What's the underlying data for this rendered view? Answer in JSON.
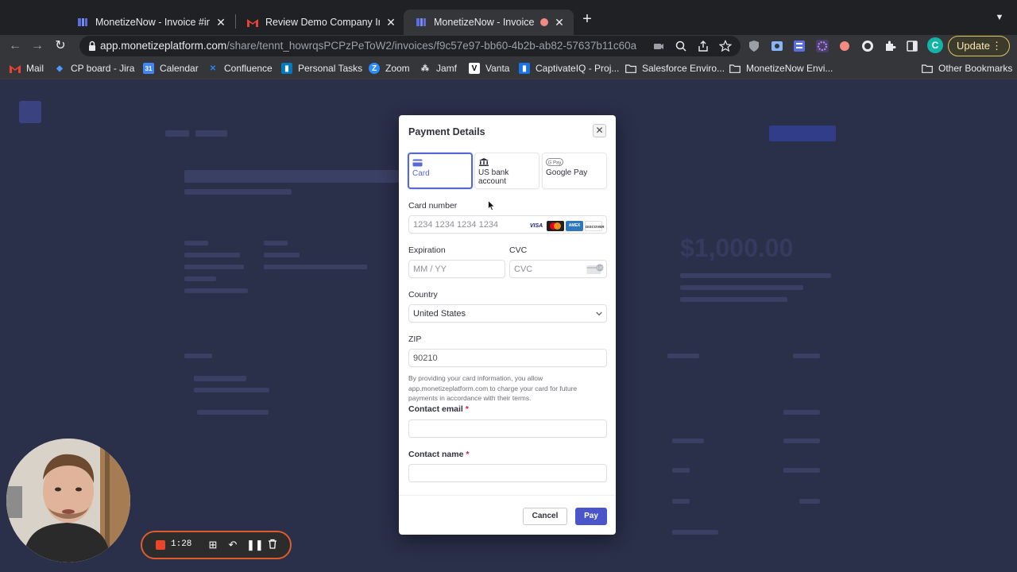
{
  "browser": {
    "tabs": [
      {
        "title": "MonetizeNow - Invoice #invce...",
        "active": false,
        "favicon": "monetizenow-favicon"
      },
      {
        "title": "Review Demo Company Invoice...",
        "active": false,
        "favicon": "gmail-favicon"
      },
      {
        "title": "MonetizeNow - Invoice #in...",
        "active": true,
        "favicon": "monetizenow-favicon",
        "recording": true
      }
    ],
    "url_host": "app.monetizeplatform.com",
    "url_path": "/share/tennt_howrqsPCPzPeToW2/invoices/f9c57e97-bb60-4b2b-ab82-57637b11c60a",
    "update_label": "Update",
    "profile_initial": "C",
    "bookmarks": [
      {
        "label": "Mail",
        "icon": "gmail-icon"
      },
      {
        "label": "CP board - Jira",
        "icon": "jira-icon"
      },
      {
        "label": "Calendar",
        "icon": "calendar-icon"
      },
      {
        "label": "Confluence",
        "icon": "confluence-icon"
      },
      {
        "label": "Personal Tasks",
        "icon": "trello-icon"
      },
      {
        "label": "Zoom",
        "icon": "zoom-icon"
      },
      {
        "label": "Jamf",
        "icon": "jamf-icon"
      },
      {
        "label": "Vanta",
        "icon": "vanta-icon"
      },
      {
        "label": "CaptivateIQ - Proj...",
        "icon": "captivateiq-icon"
      },
      {
        "label": "Salesforce Enviro...",
        "icon": "folder-icon"
      },
      {
        "label": "MonetizeNow Envi...",
        "icon": "folder-icon"
      }
    ],
    "other_bookmarks": "Other Bookmarks"
  },
  "background_page": {
    "amount": "$1,000.00"
  },
  "modal": {
    "title": "Payment Details",
    "payment_methods": [
      {
        "label": "Card",
        "active": true,
        "icon": "card-icon"
      },
      {
        "label": "US bank account",
        "active": false,
        "icon": "bank-icon"
      },
      {
        "label": "Google Pay",
        "active": false,
        "icon": "google-pay-icon"
      }
    ],
    "card_number": {
      "label": "Card number",
      "placeholder": "1234 1234 1234 1234",
      "brands": [
        "VISA",
        "Mastercard",
        "AMEX",
        "DISCOVER"
      ]
    },
    "expiration": {
      "label": "Expiration",
      "placeholder": "MM / YY"
    },
    "cvc": {
      "label": "CVC",
      "placeholder": "CVC"
    },
    "country": {
      "label": "Country",
      "value": "United States"
    },
    "zip": {
      "label": "ZIP",
      "value": "90210"
    },
    "disclaimer": "By providing your card information, you allow app.monetizeplatform.com to charge your card for future payments in accordance with their terms.",
    "contact_email": {
      "label": "Contact email",
      "required_mark": "*",
      "value": ""
    },
    "contact_name": {
      "label": "Contact name",
      "required_mark": "*",
      "value": ""
    },
    "cancel_label": "Cancel",
    "pay_label": "Pay"
  },
  "recorder": {
    "time": "1:28"
  },
  "colors": {
    "accent": "#5469d4",
    "pay_button": "#4b55c9",
    "required": "#df1b41",
    "update_border": "#e2c15f"
  }
}
